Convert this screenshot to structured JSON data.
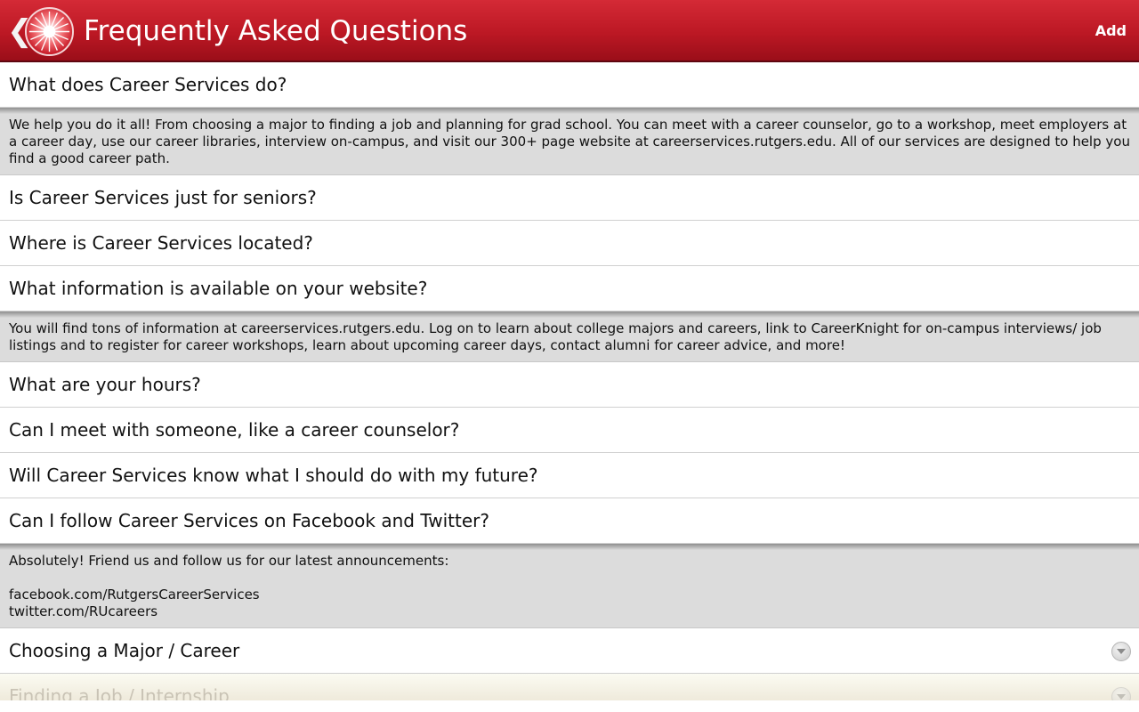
{
  "header": {
    "back_glyph": "❮",
    "logo_icon": "rutgers-sun-logo",
    "title": "Frequently Asked Questions",
    "add_label": "Add",
    "colors": {
      "bar_top": "#d42a36",
      "bar_bottom": "#9a0e19"
    }
  },
  "faq": [
    {
      "question": "What does Career Services do?",
      "expanded": true,
      "answer": "We help you do it all!  From choosing a major to finding a job and planning for grad school.  You can meet with a career counselor, go to a workshop, meet employers at a career day, use our career libraries, interview on-campus, and visit our 300+ page website at careerservices.rutgers.edu.  All of our services are designed to help you find a good career path."
    },
    {
      "question": "Is Career Services just for seniors?",
      "expanded": false
    },
    {
      "question": "Where is Career Services located?",
      "expanded": false
    },
    {
      "question": "What information is available on your website?",
      "expanded": true,
      "answer": "You will find tons of information at careerservices.rutgers.edu.  Log on to learn about college majors and careers, link to CareerKnight for on-campus interviews/ job listings and to register for career workshops, learn about upcoming career days, contact alumni for career advice, and more!"
    },
    {
      "question": "What are your hours?",
      "expanded": false
    },
    {
      "question": "Can I meet with someone, like a career counselor?",
      "expanded": false
    },
    {
      "question": "Will Career Services know what I should do with my future?",
      "expanded": false
    },
    {
      "question": "Can I follow Career Services on Facebook and Twitter?",
      "expanded": true,
      "answer": "Absolutely!  Friend us and follow us for our latest announcements:\n\nfacebook.com/RutgersCareerServices\ntwitter.com/RUcareers"
    }
  ],
  "categories": [
    {
      "label": "Choosing a Major / Career",
      "icon": "expand-arrow-icon"
    },
    {
      "label": "Finding a Job / Internship",
      "icon": "expand-arrow-icon"
    }
  ]
}
